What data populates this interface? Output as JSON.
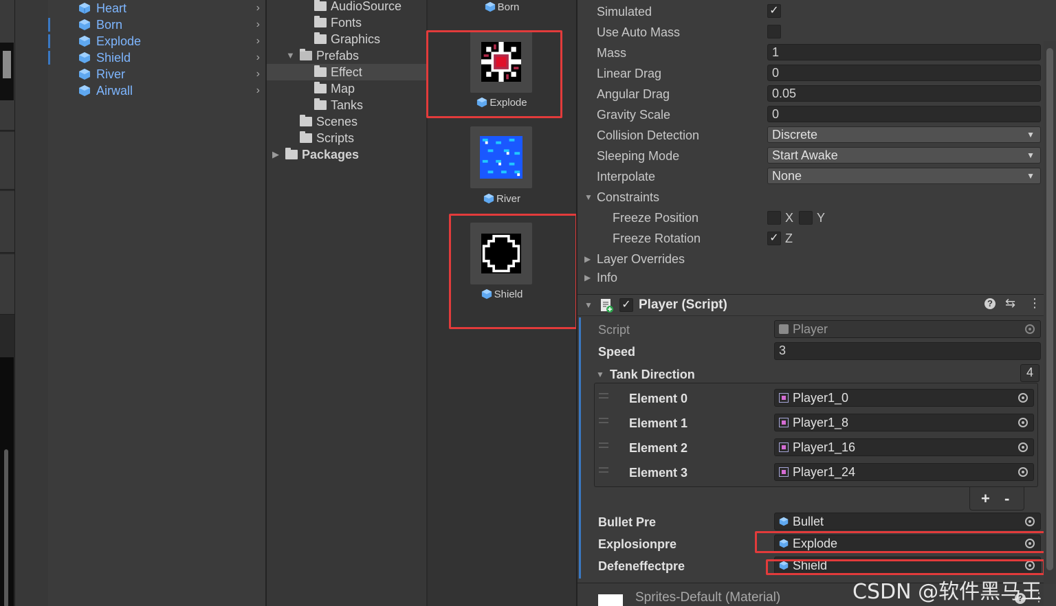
{
  "hierarchy": {
    "items": [
      {
        "label": "Heart"
      },
      {
        "label": "Born"
      },
      {
        "label": "Explode"
      },
      {
        "label": "Shield"
      },
      {
        "label": "River"
      },
      {
        "label": "Airwall"
      }
    ]
  },
  "project": {
    "folders": [
      {
        "label": "AudioSource"
      },
      {
        "label": "Fonts"
      },
      {
        "label": "Graphics"
      },
      {
        "label": "Prefabs"
      },
      {
        "label": "Effect"
      },
      {
        "label": "Map"
      },
      {
        "label": "Tanks"
      },
      {
        "label": "Scenes"
      },
      {
        "label": "Scripts"
      },
      {
        "label": "Packages"
      }
    ]
  },
  "assets": {
    "top_label": "Born",
    "items": [
      {
        "label": "Explode"
      },
      {
        "label": "River"
      },
      {
        "label": "Shield"
      }
    ]
  },
  "rigidbody": {
    "simulated_label": "Simulated",
    "use_auto_mass_label": "Use Auto Mass",
    "mass_label": "Mass",
    "mass_value": "1",
    "linear_drag_label": "Linear Drag",
    "linear_drag_value": "0",
    "angular_drag_label": "Angular Drag",
    "angular_drag_value": "0.05",
    "gravity_scale_label": "Gravity Scale",
    "gravity_scale_value": "0",
    "collision_detection_label": "Collision Detection",
    "collision_detection_value": "Discrete",
    "sleeping_mode_label": "Sleeping Mode",
    "sleeping_mode_value": "Start Awake",
    "interpolate_label": "Interpolate",
    "interpolate_value": "None",
    "constraints_label": "Constraints",
    "freeze_position_label": "Freeze Position",
    "freeze_rotation_label": "Freeze Rotation",
    "x_label": "X",
    "y_label": "Y",
    "z_label": "Z",
    "layer_overrides_label": "Layer Overrides",
    "info_label": "Info"
  },
  "player_script": {
    "title": "Player (Script)",
    "script_label": "Script",
    "script_value": "Player",
    "speed_label": "Speed",
    "speed_value": "3",
    "tank_direction_label": "Tank Direction",
    "tank_direction_count": "4",
    "elements": [
      {
        "label": "Element 0",
        "value": "Player1_0"
      },
      {
        "label": "Element 1",
        "value": "Player1_8"
      },
      {
        "label": "Element 2",
        "value": "Player1_16"
      },
      {
        "label": "Element 3",
        "value": "Player1_24"
      }
    ],
    "plus": "+",
    "minus": "-",
    "bullet_pre_label": "Bullet Pre",
    "bullet_pre_value": "Bullet",
    "explosionpre_label": "Explosionpre",
    "explosionpre_value": "Explode",
    "defeneffectpre_label": "Defeneffectpre",
    "defeneffectpre_value": "Shield"
  },
  "material": {
    "label": "Sprites-Default (Material)"
  },
  "watermark": "CSDN @软件黑马王子",
  "colors": {
    "highlight": "#e23b3b",
    "prefab_blue": "#7eb6ff",
    "accent": "#3a78c2"
  }
}
